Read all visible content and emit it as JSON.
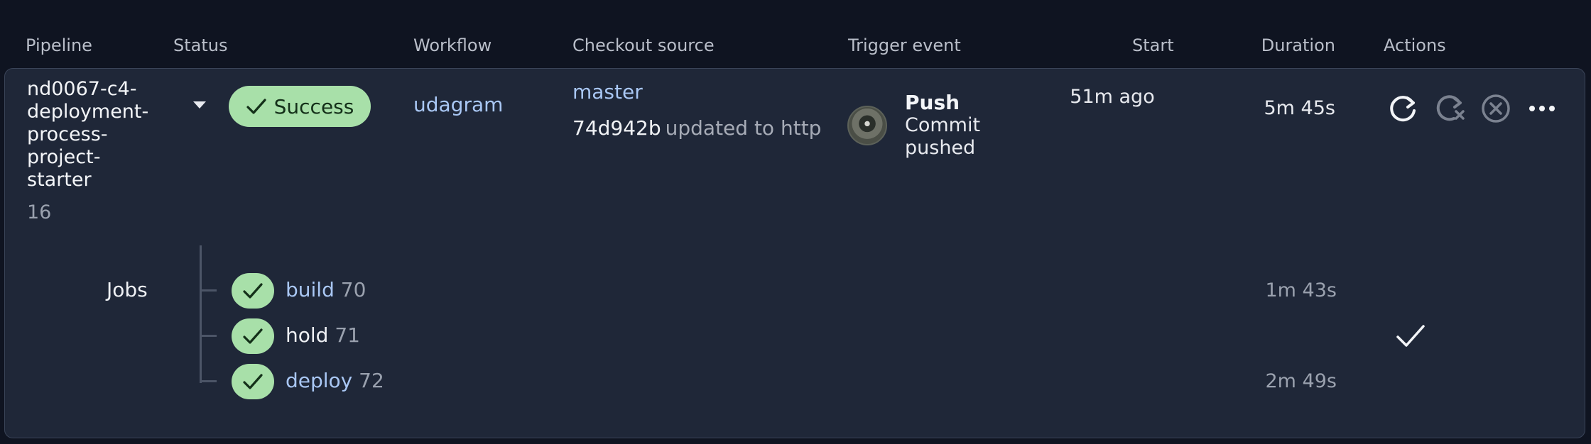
{
  "headers": {
    "pipeline": "Pipeline",
    "status": "Status",
    "workflow": "Workflow",
    "checkout_source": "Checkout source",
    "trigger_event": "Trigger event",
    "start": "Start",
    "duration": "Duration",
    "actions": "Actions"
  },
  "pipeline": {
    "name": "nd0067-c4-deployment-process-project-starter",
    "number": "16",
    "status": "Success",
    "workflow": "udagram",
    "branch": "master",
    "commit_hash": "74d942b",
    "commit_message": "updated to http",
    "trigger_title": "Push",
    "trigger_subtitle": "Commit pushed",
    "start": "51m ago",
    "duration": "5m 45s"
  },
  "actions": [
    "rerun-icon",
    "rerun-failed-icon",
    "cancel-icon",
    "more-icon"
  ],
  "jobs_label": "Jobs",
  "jobs": [
    {
      "name": "build",
      "number": "70",
      "duration": "1m 43s",
      "status": "success"
    },
    {
      "name": "hold",
      "number": "71",
      "duration": "",
      "status": "approved"
    },
    {
      "name": "deploy",
      "number": "72",
      "duration": "2m 49s",
      "status": "success"
    }
  ],
  "colors": {
    "background": "#0f1421",
    "panel": "#1f2738",
    "success": "#a8e0a9",
    "link": "#a9c7f4"
  }
}
